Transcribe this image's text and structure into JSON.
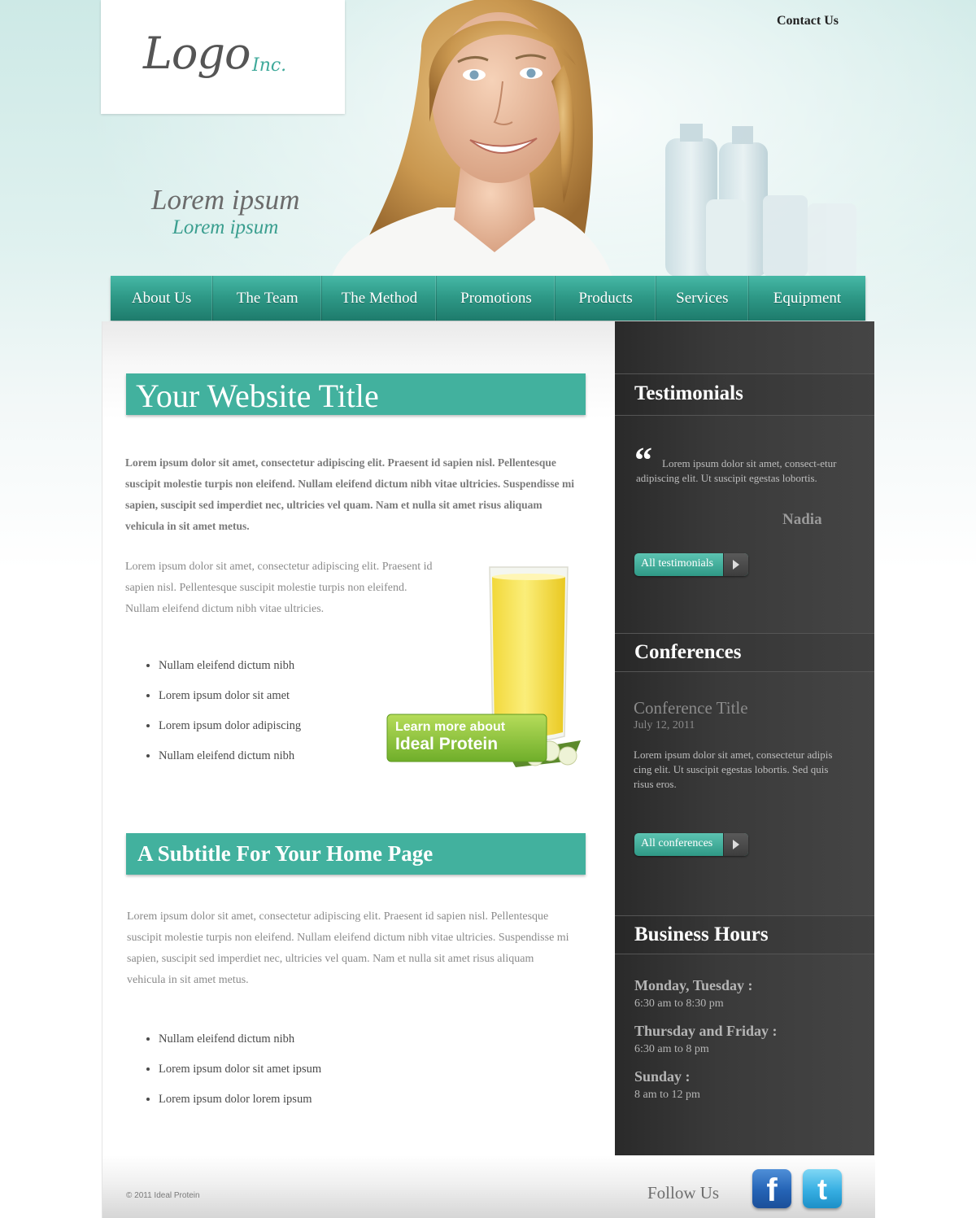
{
  "header": {
    "logo_text": "Logo",
    "logo_sub": "Inc.",
    "contact_label": "Contact Us",
    "tagline_main": "Lorem ipsum",
    "tagline_sub": "Lorem ipsum"
  },
  "nav": {
    "items": [
      "About Us",
      "The Team",
      "The Method",
      "Promotions",
      "Products",
      "Services",
      "Equipment"
    ]
  },
  "main": {
    "title": "Your Website Title",
    "intro_bold": "Lorem ipsum dolor sit amet, consectetur adipiscing elit. Praesent id sapien nisl. Pellentesque suscipit molestie turpis non eleifend. Nullam eleifend dictum nibh vitae ultricies. Suspendisse mi sapien, suscipit sed imperdiet nec, ultricies vel quam. Nam et nulla sit amet risus aliquam vehicula in sit amet metus.",
    "intro_short": "Lorem ipsum dolor sit amet, consectetur adipiscing elit. Praesent id sapien nisl. Pellentesque suscipit molestie turpis non eleifend. Nullam eleifend dictum nibh vitae ultricies.",
    "list1": [
      "Nullam eleifend dictum nibh",
      "Lorem ipsum dolor sit amet",
      "Lorem ipsum dolor adipiscing",
      "Nullam eleifend dictum nibh"
    ],
    "promo_line1": "Learn more about",
    "promo_line2": "Ideal Protein",
    "subtitle": "A Subtitle For Your Home Page",
    "body": "Lorem ipsum dolor sit amet, consectetur adipiscing elit. Praesent id sapien nisl. Pellentesque suscipit molestie turpis non eleifend. Nullam eleifend dictum nibh vitae ultricies. Suspendisse mi sapien, suscipit sed imperdiet nec, ultricies vel quam. Nam et nulla sit amet risus aliquam vehicula in sit amet metus.",
    "list2": [
      "Nullam eleifend dictum nibh",
      "Lorem ipsum dolor sit amet ipsum",
      "Lorem ipsum dolor lorem ipsum"
    ]
  },
  "sidebar": {
    "testimonials": {
      "heading": "Testimonials",
      "quote_mark": "“",
      "quote": "Lorem ipsum dolor sit amet, consect-etur adipiscing elit. Ut suscipit egestas lobortis.",
      "author": "Nadia",
      "button": "All testimonials"
    },
    "conferences": {
      "heading": "Conferences",
      "title": "Conference Title",
      "date": "July 12, 2011",
      "text": "Lorem ipsum dolor sit amet, consectetur adipis cing elit. Ut suscipit egestas lobortis. Sed quis risus eros.",
      "button": "All conferences"
    },
    "hours": {
      "heading": "Business Hours",
      "rows": [
        {
          "day": "Monday, Tuesday :",
          "time": "6:30 am to 8:30 pm"
        },
        {
          "day": "Thursday and Friday :",
          "time": "6:30 am to 8 pm"
        },
        {
          "day": "Sunday :",
          "time": "8 am to 12 pm"
        }
      ]
    }
  },
  "footer": {
    "copyright": "© 2011 Ideal Protein",
    "follow": "Follow Us",
    "facebook_glyph": "f",
    "twitter_glyph": "t"
  },
  "colors": {
    "accent": "#42b19e",
    "sidebar": "#3a3a3a",
    "nav": "#2f9a88"
  }
}
